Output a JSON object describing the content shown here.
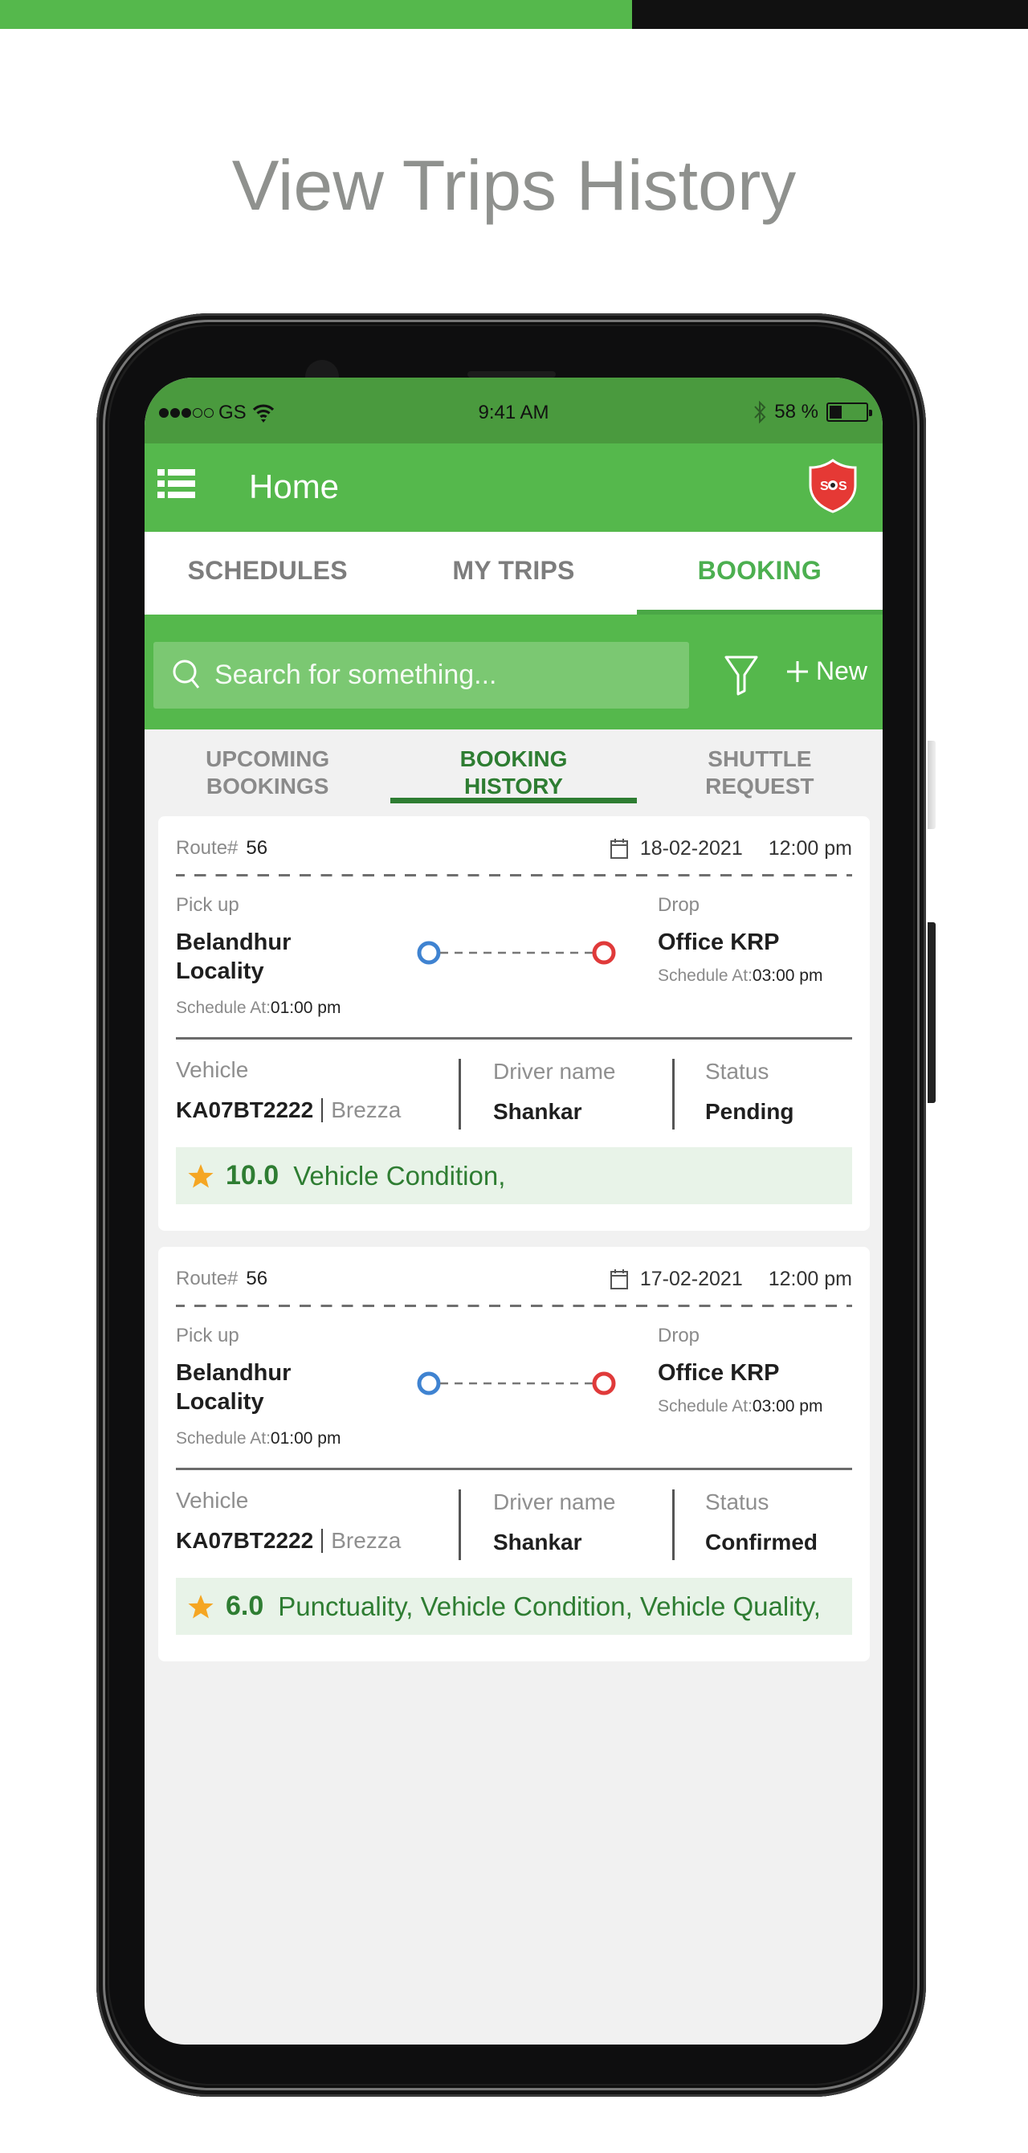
{
  "page": {
    "title": "View Trips History",
    "colors": {
      "brand_green": "#55b84c",
      "status_green": "#4a9a3e",
      "dark_green": "#2e7d32",
      "rating_bg": "#e8f3e8",
      "pickup_blue": "#3f83d1",
      "drop_red": "#e03a3a",
      "star": "#f5a623"
    }
  },
  "status_bar": {
    "carrier": "GS",
    "signal_bars_filled": 3,
    "signal_bars_total": 5,
    "time": "9:41 AM",
    "battery": "58 %",
    "battery_level": 0.58
  },
  "app_bar": {
    "menu_icon": "list-menu-icon",
    "title": "Home",
    "sos_icon": "sos-shield-icon",
    "sos_label": "SOS"
  },
  "tabs": [
    {
      "label": "SCHEDULES",
      "active": false
    },
    {
      "label": "MY TRIPS",
      "active": false
    },
    {
      "label": "BOOKING",
      "active": true
    }
  ],
  "toolbar": {
    "search_placeholder": "Search for something...",
    "filter_icon": "filter-icon",
    "new_label": "New"
  },
  "subtabs": [
    {
      "line1": "UPCOMING",
      "line2": "BOOKINGS",
      "active": false
    },
    {
      "line1": "BOOKING",
      "line2": "HISTORY",
      "active": true
    },
    {
      "line1": "SHUTTLE",
      "line2": "REQUEST",
      "active": false
    }
  ],
  "labels": {
    "route": "Route#",
    "pickup": "Pick up",
    "drop": "Drop",
    "schedule_at": "Schedule At:",
    "vehicle": "Vehicle",
    "driver": "Driver name",
    "status": "Status"
  },
  "bookings": [
    {
      "route": "56",
      "date": "18-02-2021",
      "time": "12:00 pm",
      "pickup": "Belandhur Locality",
      "pickup_time": "01:00 pm",
      "drop": "Office KRP",
      "drop_time": "03:00 pm",
      "vehicle_no": "KA07BT2222",
      "vehicle_model": "Brezza",
      "driver": "Shankar",
      "status": "Pending",
      "rating": "10.0",
      "feedback": "Vehicle Condition,"
    },
    {
      "route": "56",
      "date": "17-02-2021",
      "time": "12:00 pm",
      "pickup": "Belandhur Locality",
      "pickup_time": "01:00 pm",
      "drop": "Office KRP",
      "drop_time": "03:00 pm",
      "vehicle_no": "KA07BT2222",
      "vehicle_model": "Brezza",
      "driver": "Shankar",
      "status": "Confirmed",
      "rating": "6.0",
      "feedback": "Punctuality, Vehicle Condition, Vehicle Quality,"
    }
  ]
}
